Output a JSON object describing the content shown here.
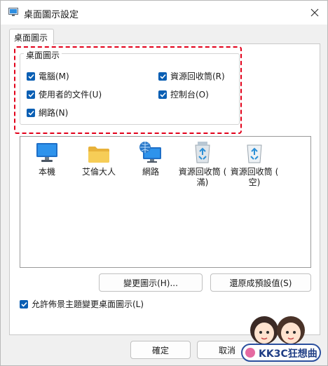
{
  "window": {
    "title": "桌面圖示設定",
    "close_symbol": "✕"
  },
  "tab": {
    "label": "桌面圖示"
  },
  "group": {
    "title": "桌面圖示",
    "checkboxes": [
      {
        "label": "電腦(M)",
        "checked": true
      },
      {
        "label": "資源回收筒(R)",
        "checked": true
      },
      {
        "label": "使用者的文件(U)",
        "checked": true
      },
      {
        "label": "控制台(O)",
        "checked": true
      },
      {
        "label": "網路(N)",
        "checked": true
      }
    ]
  },
  "icons": [
    {
      "label": "本機",
      "icon": "monitor-icon"
    },
    {
      "label": "艾倫大人",
      "icon": "folder-icon"
    },
    {
      "label": "網路",
      "icon": "network-icon"
    },
    {
      "label": "資源回收筒 ( 滿)",
      "icon": "recycle-bin-full-icon"
    },
    {
      "label": "資源回收筒 ( 空)",
      "icon": "recycle-bin-empty-icon"
    }
  ],
  "buttons": {
    "change_icon": "變更圖示(H)...",
    "restore_default": "還原成預設值(S)"
  },
  "allow_themes": {
    "label": "允許佈景主題變更桌面圖示(L)",
    "checked": true
  },
  "footer": {
    "ok": "確定",
    "cancel": "取消"
  },
  "watermark": {
    "text": "KK3C狂想曲"
  },
  "colors": {
    "accent": "#0a5fb4",
    "highlight_border": "#e2001a"
  }
}
